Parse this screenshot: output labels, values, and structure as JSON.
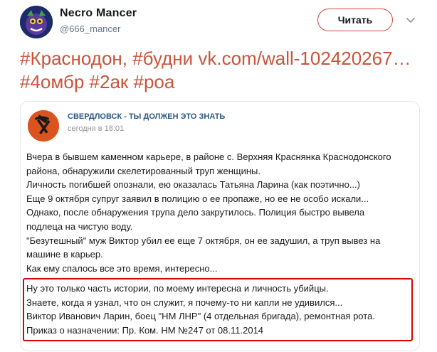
{
  "tweet": {
    "display_name": "Necro Mancer",
    "handle": "@666_mancer",
    "follow_label": "Читать",
    "text": "#Краснодон, #будни vk.com/wall-102420267… #4омбр #2ак #роа"
  },
  "embedded_post": {
    "author": "СВЕРДЛОВСК - ТЫ ДОЛЖЕН ЭТО ЗНАТЬ",
    "time": "сегодня в 18:01",
    "lines": [
      "Вчера в бывшем каменном карьере, в районе с. Верхняя Краснянка Краснодонского",
      "района, обнаружили скелетированный труп женщины.",
      "Личность погибшей опознали, ею оказалась Татьяна Ларина (как поэтично...)",
      "Еще 9 октября супруг заявил в полицию о ее пропаже, но ее не особо искали...",
      "Однако, после обнаружения трупа дело закрутилось. Полиция быстро вывела",
      "подлеца на чистую воду.",
      "\"Безутешный\" муж Виктор убил ее еще 7 октября, он ее задушил, а труп вывез на",
      "машине в карьер.",
      "Как ему спалось все это время, интересно..."
    ],
    "highlighted_lines": [
      "Ну это только часть истории, по моему интересна и личность убийцы.",
      "Знаете, когда я узнал, что он служит, я почему-то ни капли не удивился...",
      "Виктор Иванович Ларин, боец \"НМ ЛНР\" (4 отдельная бригада), ремонтная рота.",
      "Приказ о назначении: Пр. Ком. НМ №247 от 08.11.2014"
    ]
  },
  "colors": {
    "hashtag_link": "#c9543a",
    "follow_border": "#d04a3a",
    "highlight_border": "#dd0000",
    "vk_author": "#2a5885"
  },
  "icons": [
    "avatar",
    "chevron-down-icon",
    "hammer-pick-icon"
  ]
}
